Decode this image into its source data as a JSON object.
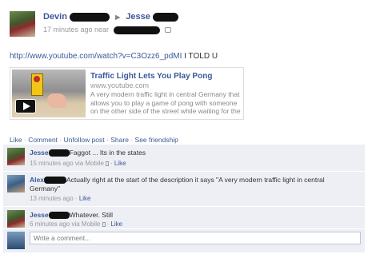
{
  "post": {
    "author": "Devin",
    "target": "Jesse",
    "time": "17 minutes ago near",
    "text": "http://www.youtube.com/watch?v=C3Ozz6_pdMI I TOLD U",
    "link_text": "http://www.youtube.com/watch?v=C3Ozz6_pdMI",
    "extra_text": " I TOLD U"
  },
  "attachment": {
    "title": "Traffic Light Lets You Play Pong",
    "domain": "www.youtube.com",
    "description": "A very modern traffic light in central Germany that allows you to play a game of pong with someone on the other side of the street while waiting for the"
  },
  "actions": {
    "like": "Like",
    "comment": "Comment",
    "unfollow": "Unfollow post",
    "share": "Share",
    "see_friendship": "See friendship",
    "sep": "·"
  },
  "comments": [
    {
      "author": "Jesse",
      "text": "Faggot ... Its in the states",
      "time": "15 minutes ago via Mobile",
      "like": "Like"
    },
    {
      "author": "Alex",
      "text": "Actually right at the start of the description it says \"A very modern traffic light in central Germany\"",
      "time": "13 minutes ago",
      "like": "Like"
    },
    {
      "author": "Jesse",
      "text": "Whatever. Still",
      "time": "6 minutes ago via Mobile",
      "like": "Like"
    }
  ],
  "write_comment": {
    "placeholder": "Write a comment..."
  }
}
